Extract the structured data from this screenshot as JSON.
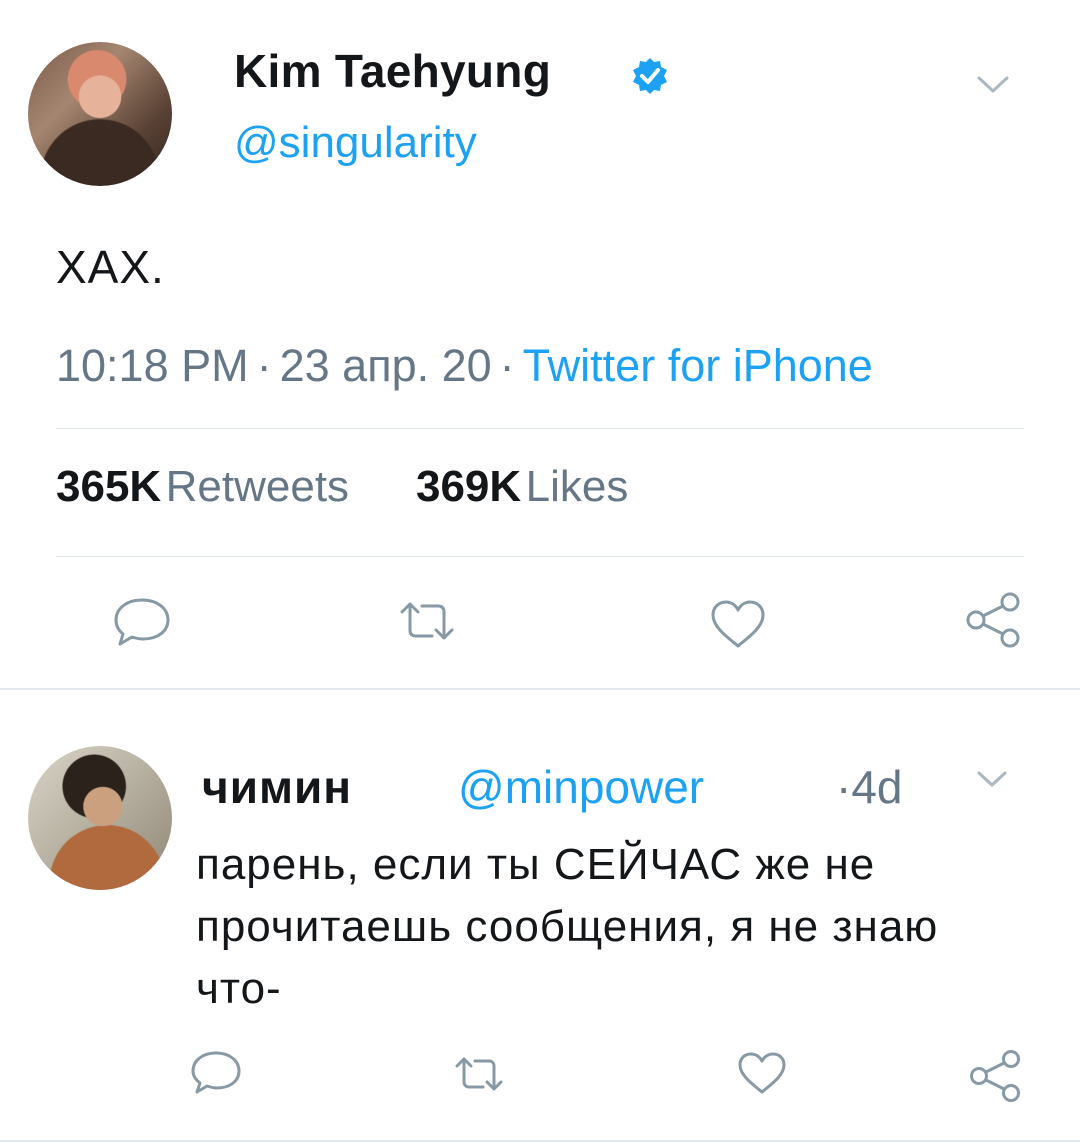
{
  "tweet": {
    "author_name": "Kim Taehyung",
    "author_handle": "@singularity",
    "text": "ХАХ.",
    "time": "10:18 PM",
    "date": "23 апр. 20",
    "source": "Twitter for iPhone",
    "separator": "·",
    "retweets_count": "365K",
    "retweets_label": "Retweets",
    "likes_count": "369K",
    "likes_label": "Likes"
  },
  "reply": {
    "author_name": "чимин",
    "author_handle": "@minpower",
    "time": "·4d",
    "text": "парень, если ты СЕЙЧАС же не прочитаешь сообщения, я не знаю что-"
  },
  "colors": {
    "accent": "#1da1f2",
    "text": "#14171a",
    "secondary": "#657786",
    "divider": "#e1e8ed"
  },
  "icons": [
    "verified-icon",
    "chevron-down-icon",
    "reply-icon",
    "retweet-icon",
    "like-icon",
    "share-icon"
  ]
}
